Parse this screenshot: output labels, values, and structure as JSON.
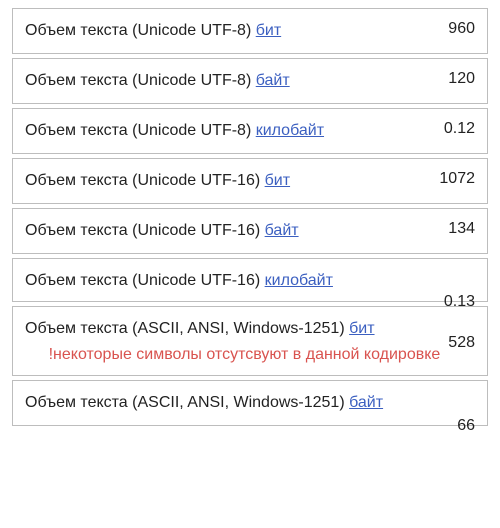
{
  "labels": {
    "prefix_utf8": "Объем текста (Unicode UTF-8) ",
    "prefix_utf16": "Объем текста (Unicode UTF-16) ",
    "prefix_ascii": "Объем текста (ASCII, ANSI, Windows-1251) ",
    "unit_bit": "бит",
    "unit_byte": "байт",
    "unit_kb": "килобайт",
    "warning": "!некоторые символы отсутсвуют в данной кодировке"
  },
  "values": {
    "utf8_bit": "960",
    "utf8_byte": "120",
    "utf8_kb": "0.12",
    "utf16_bit": "1072",
    "utf16_byte": "134",
    "utf16_kb": "0.13",
    "ascii_bit": "528",
    "ascii_byte": "66"
  }
}
